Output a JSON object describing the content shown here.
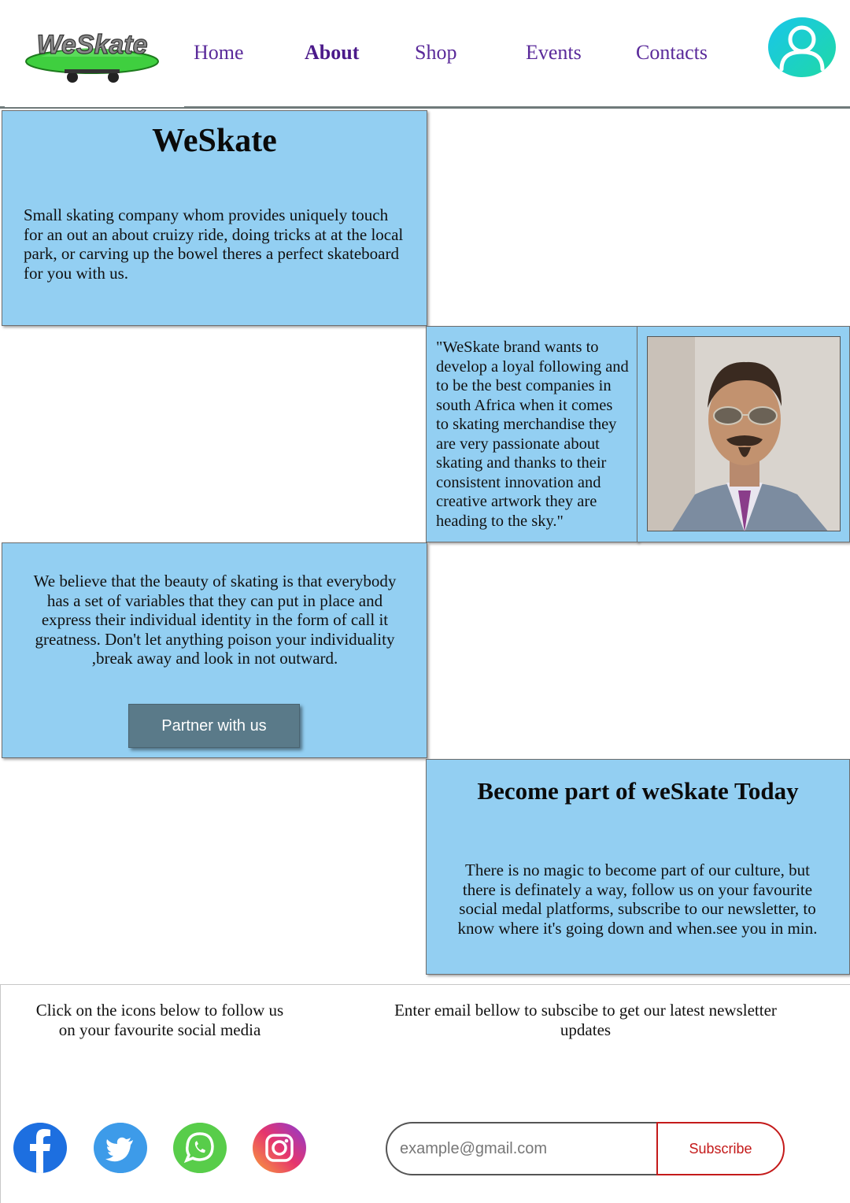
{
  "header": {
    "logo_text": "WeSkate",
    "nav": [
      {
        "label": "Home",
        "active": false
      },
      {
        "label": "About",
        "active": true
      },
      {
        "label": "Shop",
        "active": false
      },
      {
        "label": "Events",
        "active": false
      },
      {
        "label": "Contacts",
        "active": false
      }
    ],
    "avatar_icon": "user-icon",
    "avatar_gradient": [
      "#19c6ea",
      "#1fd9a6"
    ]
  },
  "intro": {
    "title": "WeSkate",
    "text": "Small skating company whom provides uniquely touch for an out an about cruizy ride, doing tricks at at the local park, or carving up the bowel theres a perfect skateboard for you with us."
  },
  "quote": {
    "text": "\"WeSkate brand wants to develop a loyal following and to be the best companies in south Africa when it comes to skating merchandise they are very passionate about skating and thanks to their consistent innovation and creative artwork they are heading to the sky.\""
  },
  "belief": {
    "text": "We believe that the beauty of skating is that everybody has a set of variables that they can put in place and express their individual identity in the form of call it greatness. Don't let anything poison your individuality ,break away and look in not outward.",
    "button_label": "Partner with us"
  },
  "join": {
    "title": "Become part of weSkate Today",
    "text": "There is no magic to become part of our culture, but there is definately a way, follow us on your favourite social medal platforms, subscribe to our newsletter, to know where it's going down and when.see you in min."
  },
  "footer": {
    "social_text": "Click on the icons below to follow us on your favourite social media",
    "newsletter_text": "Enter email bellow to subscibe to get our latest newsletter updates",
    "social_icons": [
      "facebook-icon",
      "twitter-icon",
      "whatsapp-icon",
      "instagram-icon"
    ],
    "email_placeholder": "example@gmail.com",
    "subscribe_label": "Subscribe"
  },
  "colors": {
    "panel": "#93cff2",
    "nav_text": "#5a2a9a",
    "button": "#5a7a89",
    "subscribe": "#c41a1a"
  }
}
